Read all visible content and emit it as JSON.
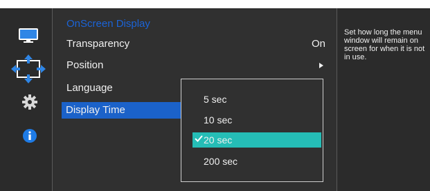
{
  "menu": {
    "title": "OnScreen Display",
    "items": [
      {
        "label": "Transparency",
        "value": "On"
      },
      {
        "label": "Position",
        "value": ""
      },
      {
        "label": "Language",
        "value": ""
      },
      {
        "label": "Display Time",
        "value": ""
      }
    ]
  },
  "dropdown": {
    "options": [
      "5 sec",
      "10 sec",
      "20 sec",
      "200 sec"
    ],
    "selected": "20 sec"
  },
  "help": {
    "text": "Set how long the menu window will remain on screen for when it is not in use."
  },
  "colors": {
    "panel_bg": "#303030",
    "side_bg": "#2b2b2b",
    "title_blue": "#1b64d8",
    "selected_blue": "#1b62c9",
    "selected_option": "#25bdb6"
  },
  "icons": [
    "monitor-icon",
    "move-position-icon",
    "gear-icon",
    "info-icon"
  ]
}
